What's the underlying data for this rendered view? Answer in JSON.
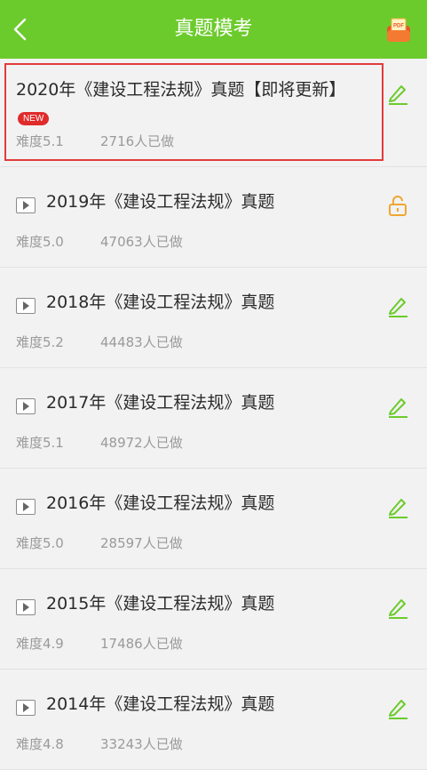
{
  "header": {
    "title": "真题模考",
    "pdf_icon_text": "PDF",
    "bg": "#6ccb2c"
  },
  "items": [
    {
      "title": "2020年《建设工程法规》真题【即将更新】",
      "badge": "NEW",
      "difficulty": "难度5.1",
      "count": "2716人已做",
      "icon": "edit-icon",
      "highlighted": true
    },
    {
      "title": "2019年《建设工程法规》真题",
      "difficulty": "难度5.0",
      "count": "47063人已做",
      "icon": "unlock-icon"
    },
    {
      "title": "2018年《建设工程法规》真题",
      "difficulty": "难度5.2",
      "count": "44483人已做",
      "icon": "edit-icon"
    },
    {
      "title": "2017年《建设工程法规》真题",
      "difficulty": "难度5.1",
      "count": "48972人已做",
      "icon": "edit-icon"
    },
    {
      "title": "2016年《建设工程法规》真题",
      "difficulty": "难度5.0",
      "count": "28597人已做",
      "icon": "edit-icon"
    },
    {
      "title": "2015年《建设工程法规》真题",
      "difficulty": "难度4.9",
      "count": "17486人已做",
      "icon": "edit-icon"
    },
    {
      "title": "2014年《建设工程法规》真题",
      "difficulty": "难度4.8",
      "count": "33243人已做",
      "icon": "edit-icon"
    }
  ],
  "colors": {
    "accent": "#6ccb2c",
    "highlight": "#e23b3b",
    "lock": "#f0a630"
  }
}
